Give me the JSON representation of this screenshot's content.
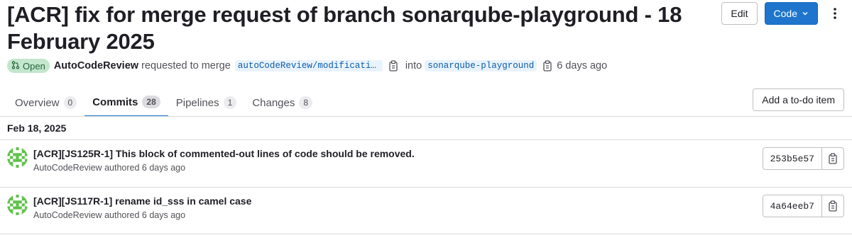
{
  "mr": {
    "title": "[ACR] fix for merge request of branch sonarqube-playground - 18 February 2025",
    "status": "Open",
    "author": "AutoCodeReview",
    "requested_text": "requested to merge",
    "source_branch": "autoCodeReview/modificatio…",
    "into_text": "into",
    "target_branch": "sonarqube-playground",
    "time_ago": "6 days ago"
  },
  "header_actions": {
    "edit_label": "Edit",
    "code_label": "Code"
  },
  "tabs": [
    {
      "label": "Overview",
      "count": "0",
      "active": false
    },
    {
      "label": "Commits",
      "count": "28",
      "active": true
    },
    {
      "label": "Pipelines",
      "count": "1",
      "active": false
    },
    {
      "label": "Changes",
      "count": "8",
      "active": false
    }
  ],
  "todo_label": "Add a to-do item",
  "commit_group_date": "Feb 18, 2025",
  "commits": [
    {
      "title": "[ACR][JS125R-1] This block of commented-out lines of code should be removed.",
      "author": "AutoCodeReview",
      "authored_text": "authored 6 days ago",
      "sha": "253b5e57"
    },
    {
      "title": "[ACR][JS117R-1] rename id_sss in camel case",
      "author": "AutoCodeReview",
      "authored_text": "authored 6 days ago",
      "sha": "4a64eeb7"
    }
  ],
  "colors": {
    "primary": "#1f75cb",
    "open_badge_bg": "#c3e6cd",
    "open_badge_fg": "#24663b",
    "avatar_green": "#5fc14a"
  }
}
